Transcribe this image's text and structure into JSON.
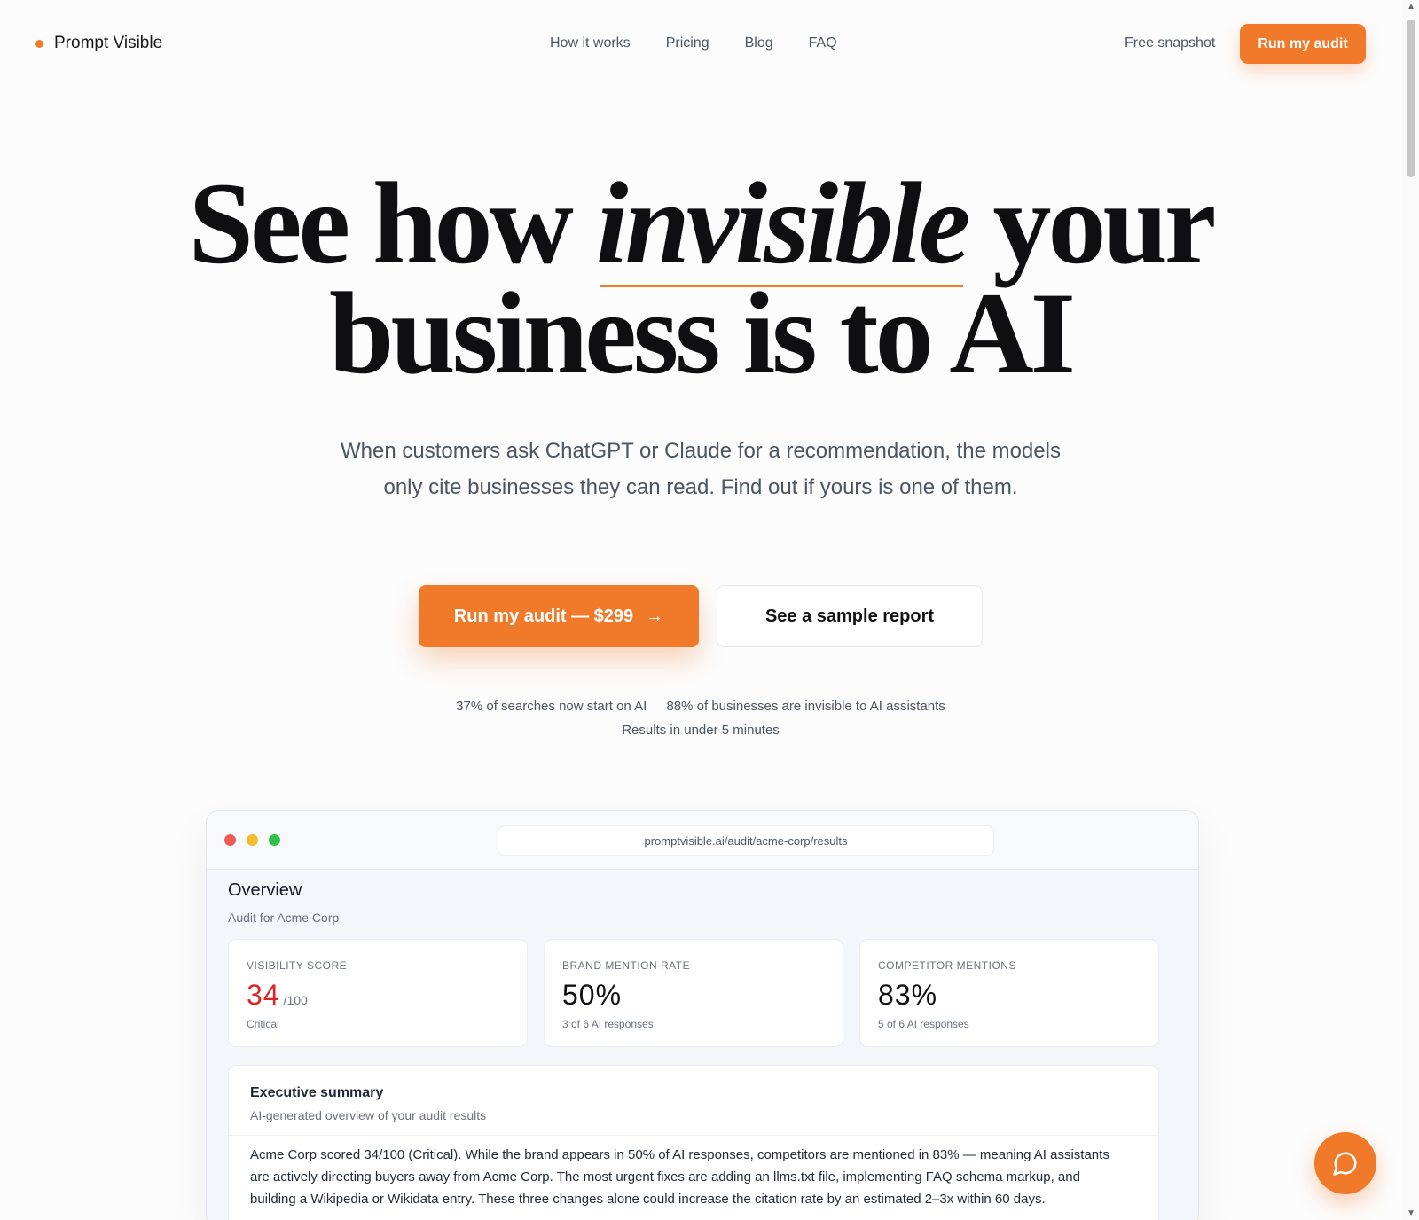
{
  "brand": {
    "name": "Prompt Visible",
    "accent": "#f07a2a"
  },
  "nav": {
    "links": [
      "How it works",
      "Pricing",
      "Blog",
      "FAQ"
    ],
    "snapshot": "Free snapshot",
    "cta": "Run my audit"
  },
  "hero": {
    "title_pre": "See how ",
    "title_em": "invisible",
    "title_post": " your",
    "title_line2": "business is to AI",
    "subtitle": "When customers ask ChatGPT or Claude for a recommendation, the models only cite businesses they can read. Find out if yours is one of them.",
    "cta_primary": "Run my audit — $299",
    "cta_primary_icon": "arrow-right-icon",
    "cta_secondary": "See a sample report",
    "stat1": "37% of searches now start on AI",
    "stat2": "88% of businesses are invisible to AI assistants",
    "stat3": "Results in under 5 minutes"
  },
  "mockup": {
    "url": "promptvisible.ai/audit/acme-corp/results",
    "overview_title": "Overview",
    "overview_sub": "Audit for Acme Corp",
    "cards": [
      {
        "label": "VISIBILITY SCORE",
        "value": "34",
        "unit": "/100",
        "note": "Critical",
        "value_color": "#dc2626"
      },
      {
        "label": "BRAND MENTION RATE",
        "value": "50%",
        "unit": "",
        "note": "3 of 6 AI responses"
      },
      {
        "label": "COMPETITOR MENTIONS",
        "value": "83%",
        "unit": "",
        "note": "5 of 6 AI responses"
      }
    ],
    "exec_title": "Executive summary",
    "exec_sub": "AI-generated overview of your audit results",
    "exec_body": "Acme Corp scored 34/100 (Critical). While the brand appears in 50% of AI responses, competitors are mentioned in 83% — meaning AI assistants are actively directing buyers away from Acme Corp. The most urgent fixes are adding an llms.txt file, implementing FAQ schema markup, and building a Wikipedia or Wikidata entry. These three changes alone could increase the citation rate by an estimated 2–3x within 60 days."
  },
  "chat": {
    "icon": "chat-bubble-icon"
  }
}
